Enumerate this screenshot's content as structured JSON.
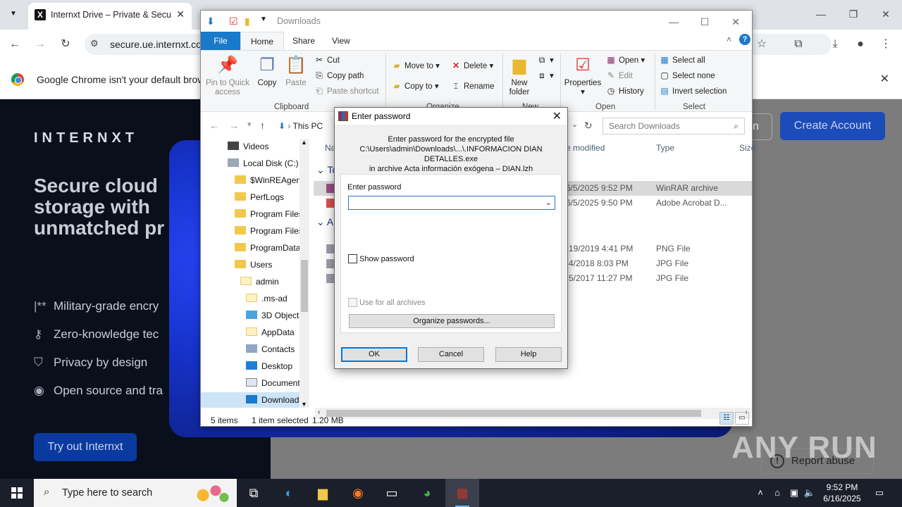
{
  "chrome": {
    "tab_title": "Internxt Drive – Private & Secure",
    "url": "secure.ue.internxt.com",
    "infobar_text": "Google Chrome isn't your default browser"
  },
  "page": {
    "brand": "INTERNXT",
    "hero_title": "Secure cloud storage with unmatched pr",
    "features": [
      {
        "icon": "asterisk-icon",
        "label": "Military-grade encry"
      },
      {
        "icon": "key-icon",
        "label": "Zero-knowledge tec"
      },
      {
        "icon": "shield-icon",
        "label": "Privacy by design"
      },
      {
        "icon": "eye-icon",
        "label": "Open source and tra"
      }
    ],
    "try_button": "Try out Internxt",
    "signin_fragment": "n",
    "create_button": "Create Account",
    "report_button": "Report abuse",
    "watermark": "ANY RUN"
  },
  "explorer": {
    "title": "Downloads",
    "tabs": [
      "File",
      "Home",
      "Share",
      "View"
    ],
    "ribbon": {
      "pin": "Pin to Quick access",
      "copy": "Copy",
      "paste": "Paste",
      "cut": "Cut",
      "copy_path": "Copy path",
      "paste_shortcut": "Paste shortcut",
      "move_to": "Move to",
      "copy_to": "Copy to",
      "delete": "Delete",
      "rename": "Rename",
      "new_folder": "New folder",
      "properties": "Properties",
      "open": "Open",
      "edit": "Edit",
      "history": "History",
      "select_all": "Select all",
      "select_none": "Select none",
      "invert_selection": "Invert selection",
      "groups": [
        "Clipboard",
        "Organize",
        "New",
        "Open",
        "Select"
      ]
    },
    "breadcrumb": "This PC",
    "search_placeholder": "Search Downloads",
    "nav_items": [
      {
        "label": "Videos",
        "icon": "videos-icon",
        "indent": 0
      },
      {
        "label": "Local Disk (C:)",
        "icon": "drive-icon",
        "indent": 0
      },
      {
        "label": "$WinREAgent",
        "icon": "folder-icon",
        "indent": 1
      },
      {
        "label": "PerfLogs",
        "icon": "folder-icon",
        "indent": 1
      },
      {
        "label": "Program Files",
        "icon": "folder-icon",
        "indent": 1
      },
      {
        "label": "Program Files",
        "icon": "folder-icon",
        "indent": 1
      },
      {
        "label": "ProgramData",
        "icon": "folder-icon",
        "indent": 1
      },
      {
        "label": "Users",
        "icon": "folder-icon",
        "indent": 1
      },
      {
        "label": "admin",
        "icon": "folder-icon",
        "indent": 2
      },
      {
        "label": ".ms-ad",
        "icon": "folder-icon",
        "indent": 3
      },
      {
        "label": "3D Objects",
        "icon": "3d-objects-icon",
        "indent": 3
      },
      {
        "label": "AppData",
        "icon": "folder-icon",
        "indent": 3
      },
      {
        "label": "Contacts",
        "icon": "contacts-icon",
        "indent": 3
      },
      {
        "label": "Desktop",
        "icon": "desktop-icon",
        "indent": 3
      },
      {
        "label": "Documents",
        "icon": "documents-icon",
        "indent": 3
      },
      {
        "label": "Downloads",
        "icon": "downloads-icon",
        "indent": 3
      }
    ],
    "columns": {
      "name": "Na",
      "date": "e modified",
      "type": "Type",
      "size": "Size"
    },
    "group_today": "To",
    "group_earlier": "A",
    "files": [
      {
        "date": "6/5/2025 9:52 PM",
        "type": "WinRAR archive",
        "selected": true
      },
      {
        "date": "6/5/2025 9:50 PM",
        "type": "Adobe Acrobat D...",
        "selected": false
      },
      {
        "date": "19/2019 4:41 PM",
        "type": "PNG File",
        "selected": false
      },
      {
        "date": "4/2018 8:03 PM",
        "type": "JPG File",
        "selected": false
      },
      {
        "date": "5/2017 11:27 PM",
        "type": "JPG File",
        "selected": false
      }
    ],
    "status_items": "5 items",
    "status_selected": "1 item selected",
    "status_size": "1.20 MB"
  },
  "dialog": {
    "title": "Enter password",
    "info_line1": "Enter password for the encrypted file",
    "info_line2": "C:\\Users\\admin\\Downloads\\...\\.INFORMACION DIAN DETALLES.exe",
    "info_line3": "in archive Acta información exógena – DIAN.lzh",
    "password_label": "Enter password",
    "password_value": "",
    "show_password": "Show password",
    "use_for_all": "Use for all archives",
    "organize": "Organize passwords...",
    "ok": "OK",
    "cancel": "Cancel",
    "help": "Help"
  },
  "taskbar": {
    "search_placeholder": "Type here to search",
    "time": "9:52 PM",
    "date": "6/16/2025"
  }
}
